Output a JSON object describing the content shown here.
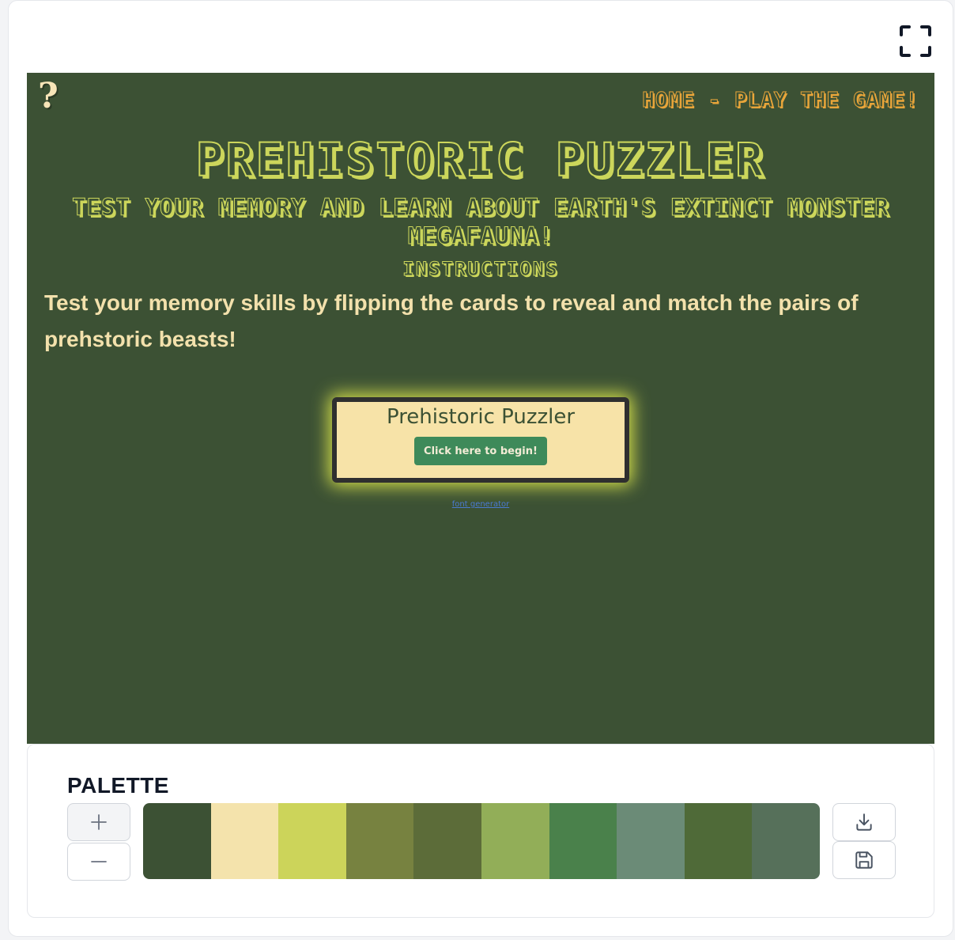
{
  "preview": {
    "help_icon": "?",
    "nav_link": "HOME - PLAY THE GAME!",
    "title": "PREHISTORIC PUZZLER",
    "subtitle": "TEST YOUR MEMORY AND LEARN ABOUT EARTH'S EXTINCT MONSTER MEGAFAUNA!",
    "instructions_heading": "INSTRUCTIONS",
    "instructions_text": "Test your memory skills by flipping the cards to reveal and match the pairs of prehstoric beasts!",
    "game_box": {
      "title": "Prehistoric Puzzler",
      "button_label": "Click here to begin!"
    },
    "font_link": "font generator"
  },
  "palette": {
    "label": "PALETTE",
    "colors": [
      "#3c5134",
      "#f4e3ac",
      "#ccd45a",
      "#778240",
      "#5c6c39",
      "#92ae58",
      "#4a814b",
      "#6b8b77",
      "#4f6a38",
      "#56705a"
    ]
  },
  "icons": {
    "fullscreen": "fullscreen-icon",
    "add": "plus-icon",
    "remove": "minus-icon",
    "download": "download-icon",
    "save": "save-icon"
  }
}
